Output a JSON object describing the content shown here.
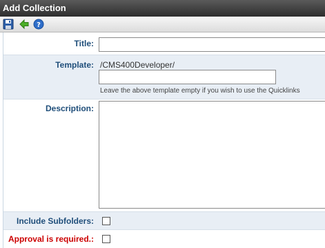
{
  "window": {
    "title": "Add Collection"
  },
  "toolbar": {
    "save_icon": "save-icon",
    "back_icon": "back-arrow-icon",
    "help_icon": "help-icon"
  },
  "form": {
    "title_label": "Title:",
    "title_value": "",
    "template_label": "Template:",
    "template_path": "/CMS400Developer/",
    "template_value": "",
    "template_hint": "Leave the above template empty if you wish to use the Quicklinks",
    "description_label": "Description:",
    "description_value": "",
    "include_subfolders_label": "Include Subfolders:",
    "include_subfolders_checked": false,
    "approval_label": "Approval is required.:",
    "approval_checked": false
  }
}
